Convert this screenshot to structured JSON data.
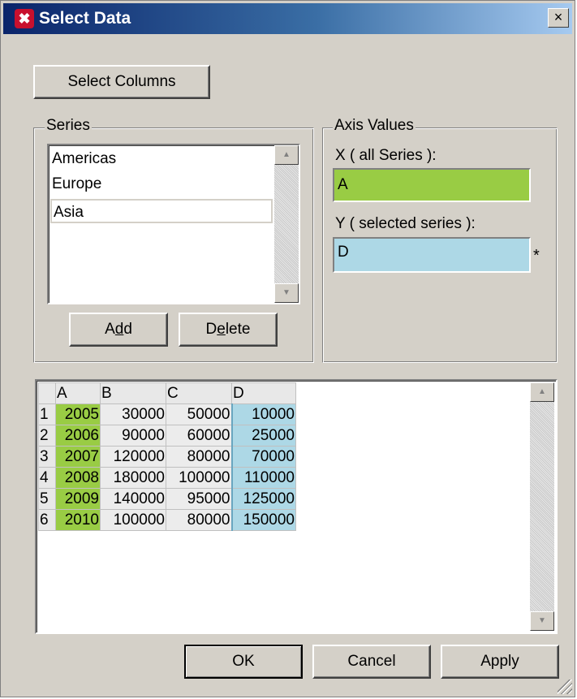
{
  "dialog": {
    "title": "Select Data",
    "close_glyph": "×"
  },
  "buttons": {
    "select_columns": "Select Columns",
    "add": "Add",
    "delete": "Delete",
    "ok": "OK",
    "cancel": "Cancel",
    "apply": "Apply"
  },
  "series": {
    "legend": "Series",
    "items": [
      "Americas",
      "Europe",
      "Asia"
    ],
    "selected_index": 2
  },
  "axis": {
    "legend": "Axis Values",
    "x_label": "X ( all Series ):",
    "x_value": "A",
    "y_label": "Y ( selected series ):",
    "y_value": "D",
    "y_marker": "*"
  },
  "grid": {
    "columns": [
      "A",
      "B",
      "C",
      "D"
    ],
    "rows": [
      {
        "num": "1",
        "cells": [
          "2005",
          "30000",
          "50000",
          "10000"
        ]
      },
      {
        "num": "2",
        "cells": [
          "2006",
          "90000",
          "60000",
          "25000"
        ]
      },
      {
        "num": "3",
        "cells": [
          "2007",
          "120000",
          "80000",
          "70000"
        ]
      },
      {
        "num": "4",
        "cells": [
          "2008",
          "180000",
          "100000",
          "110000"
        ]
      },
      {
        "num": "5",
        "cells": [
          "2009",
          "140000",
          "95000",
          "125000"
        ]
      },
      {
        "num": "6",
        "cells": [
          "2010",
          "100000",
          "80000",
          "150000"
        ]
      }
    ]
  },
  "colors": {
    "x_axis_highlight": "#99cc44",
    "y_axis_highlight": "#add8e6",
    "dialog_face": "#d4d0c8"
  },
  "icons": {
    "title": "app-x-icon",
    "scroll_up": "arrow-up-icon",
    "scroll_down": "arrow-down-icon"
  }
}
